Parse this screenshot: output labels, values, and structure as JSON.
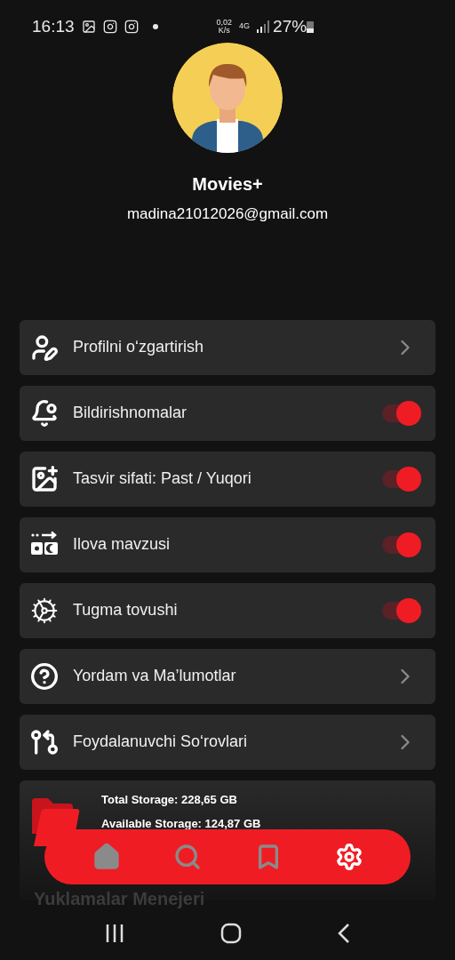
{
  "status_bar": {
    "time": "16:13",
    "speed": "0,02",
    "speed_unit": "K/s",
    "network": "4G",
    "battery": "27%"
  },
  "profile": {
    "name": "Movies+",
    "email": "madina21012026@gmail.com"
  },
  "menu": [
    {
      "kind": "link",
      "label": "Profilni o‘zgartirish"
    },
    {
      "kind": "toggle",
      "label": "Bildirishnomalar",
      "on": true
    },
    {
      "kind": "toggle",
      "label": "Tasvir sifati: Past / Yuqori",
      "on": true
    },
    {
      "kind": "toggle",
      "label": "Ilova mavzusi",
      "on": true
    },
    {
      "kind": "toggle",
      "label": "Tugma tovushi",
      "on": true
    },
    {
      "kind": "link",
      "label": "Yordam va Ma’lumotlar"
    },
    {
      "kind": "link",
      "label": "Foydalanuvchi So‘rovlari"
    }
  ],
  "storage": {
    "total": "Total Storage: 228,65 GB",
    "available": "Available Storage: 124,87 GB",
    "title": "Yuklamalar Menejeri"
  },
  "bottom_nav": [
    {
      "selected": false
    },
    {
      "selected": false
    },
    {
      "selected": false
    },
    {
      "selected": true
    }
  ]
}
